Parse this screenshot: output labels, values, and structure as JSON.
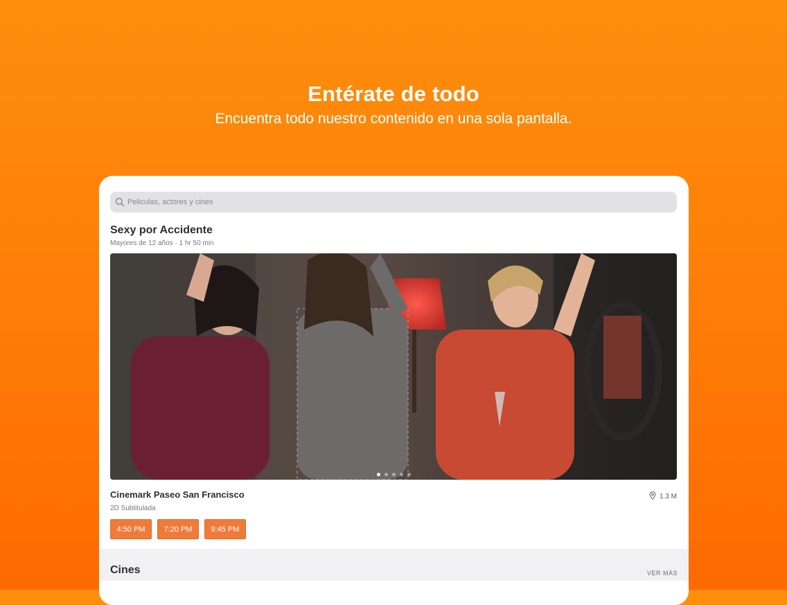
{
  "hero": {
    "title": "Entérate de todo",
    "subtitle": "Encuentra todo nuestro contenido en una sola pantalla."
  },
  "search": {
    "placeholder": "Peliculas, actores y cines",
    "icon": "search-icon"
  },
  "movie": {
    "title": "Sexy por Accidente",
    "meta": "Mayores de 12 años · 1 hr 50 min",
    "carousel": {
      "slides": 5,
      "active_index": 0
    }
  },
  "cinema": {
    "name": "Cinemark Paseo San Francisco",
    "format": "2D Subtitulada",
    "distance": "1.3 M",
    "distance_icon": "location-pin-icon",
    "showtimes": [
      "4:50 PM",
      "7:20 PM",
      "9:45 PM"
    ]
  },
  "section": {
    "title": "Cines",
    "see_more": "VER MÁS"
  },
  "colors": {
    "accent": "#f07a3a",
    "background_top": "#fe8e0c",
    "background_bottom": "#fd6a02"
  }
}
